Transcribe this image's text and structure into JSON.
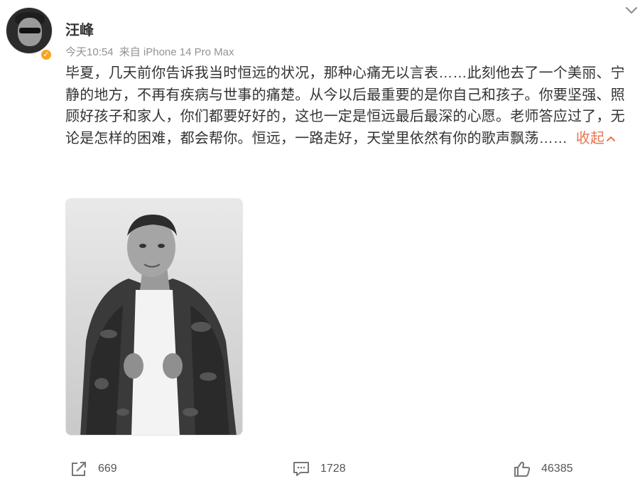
{
  "post": {
    "author": {
      "name": "汪峰",
      "avatar_icon": "avatar-photo",
      "verified_icon": "verified-badge-icon",
      "verified_color": "#f5a623"
    },
    "meta": {
      "time": "今天10:54",
      "source": "来自 iPhone 14 Pro Max"
    },
    "content": {
      "text": "毕夏，几天前你告诉我当时恒远的状况，那种心痛无以言表……此刻他去了一个美丽、宁静的地方，不再有疾病与世事的痛楚。从今以后最重要的是你自己和孩子。你要坚强、照顾好孩子和家人，你们都要好好的，这也一定是恒远最后最深的心愿。老师答应过了，无论是怎样的困难，都会帮你。恒远，一路走好，天堂里依然有你的歌声飘荡……",
      "collapse_label": "收起",
      "accent_color": "#eb7350"
    },
    "image": {
      "icon": "photo-thumbnail"
    },
    "actions": {
      "repost": {
        "icon": "repost-icon",
        "count": "669"
      },
      "comment": {
        "icon": "comment-icon",
        "count": "1728"
      },
      "like": {
        "icon": "like-icon",
        "count": "46385"
      }
    },
    "more_icon": "chevron-down-icon"
  }
}
